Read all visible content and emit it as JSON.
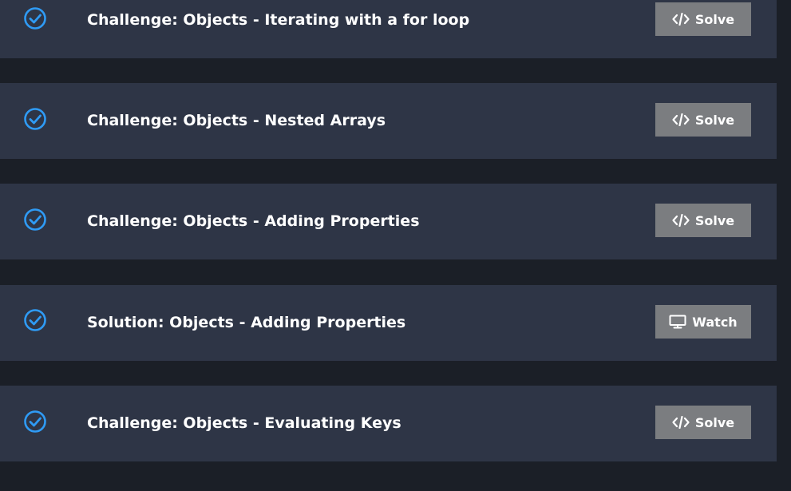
{
  "colors": {
    "page_background": "#1b1f27",
    "row_background": "#2e3546",
    "check_accent": "#2f9bf5",
    "button_background": "#7b7d80",
    "text": "#ffffff"
  },
  "lessons": [
    {
      "title": "Challenge: Objects - Iterating with a for loop",
      "completed": true,
      "action": {
        "label": "Solve",
        "icon": "code-icon"
      }
    },
    {
      "title": "Challenge: Objects - Nested Arrays",
      "completed": true,
      "action": {
        "label": "Solve",
        "icon": "code-icon"
      }
    },
    {
      "title": "Challenge: Objects - Adding Properties",
      "completed": true,
      "action": {
        "label": "Solve",
        "icon": "code-icon"
      }
    },
    {
      "title": "Solution: Objects - Adding Properties",
      "completed": true,
      "action": {
        "label": "Watch",
        "icon": "monitor-icon"
      }
    },
    {
      "title": "Challenge: Objects - Evaluating Keys",
      "completed": true,
      "action": {
        "label": "Solve",
        "icon": "code-icon"
      }
    }
  ]
}
